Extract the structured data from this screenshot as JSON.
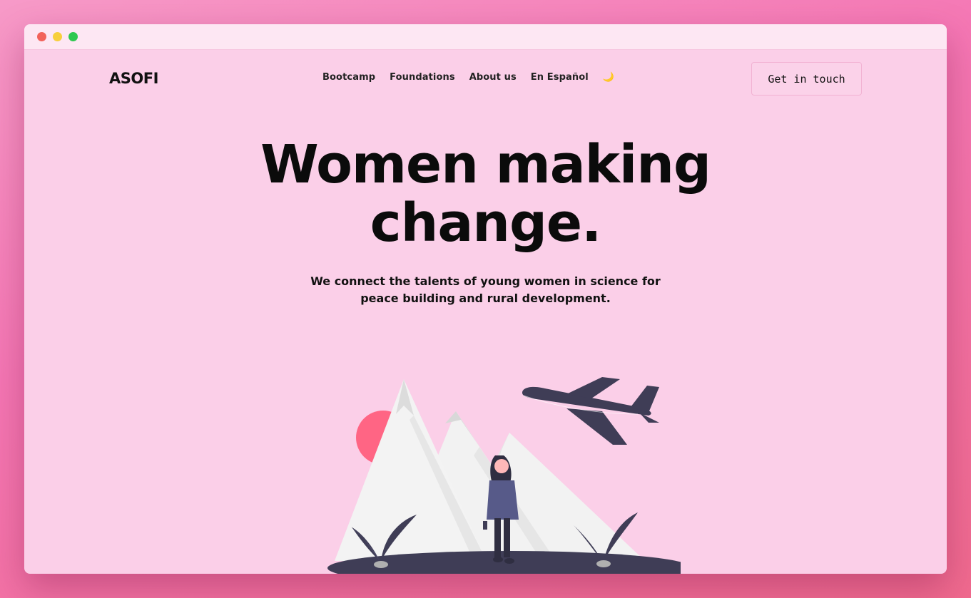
{
  "window": {
    "controls": [
      "close",
      "minimize",
      "maximize"
    ]
  },
  "nav": {
    "logo": "ASOFI",
    "links": [
      "Bootcamp",
      "Foundations",
      "About us",
      "En Español"
    ],
    "theme_toggle_icon": "moon-icon",
    "cta_label": "Get in touch"
  },
  "hero": {
    "title_line1": "Women making",
    "title_line2": "change.",
    "subtitle_line1": "We connect the talents of young women in science for",
    "subtitle_line2": "peace building and rural development."
  },
  "colors": {
    "background": "#fbcfe8",
    "accent_sun": "#ff6584",
    "dark": "#3f3d56",
    "mountain": "#f2f2f2"
  }
}
